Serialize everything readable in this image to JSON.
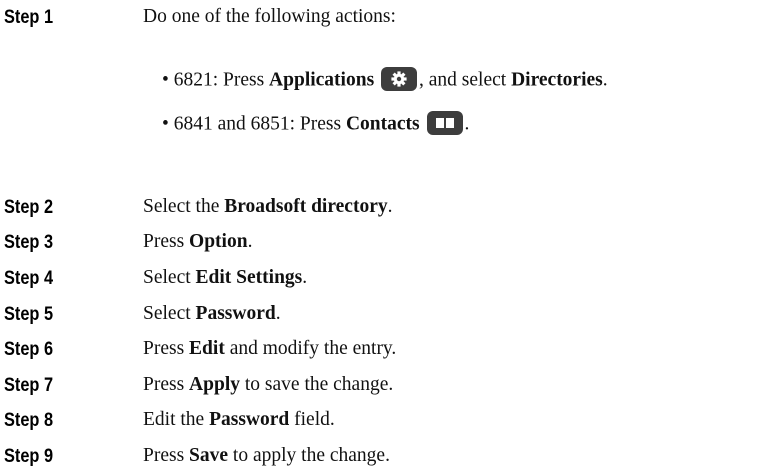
{
  "steps": [
    {
      "label": "Step 1",
      "text": "Do one of the following actions:"
    },
    {
      "label": "Step 2",
      "prefix": "Select the ",
      "bold": "Broadsoft directory",
      "suffix": "."
    },
    {
      "label": "Step 3",
      "prefix": "Press ",
      "bold": "Option",
      "suffix": "."
    },
    {
      "label": "Step 4",
      "prefix": "Select ",
      "bold": "Edit Settings",
      "suffix": "."
    },
    {
      "label": "Step 5",
      "prefix": "Select ",
      "bold": "Password",
      "suffix": "."
    },
    {
      "label": "Step 6",
      "prefix": "Press ",
      "bold": "Edit",
      "suffix": " and modify the entry."
    },
    {
      "label": "Step 7",
      "prefix": "Press ",
      "bold": "Apply",
      "suffix": " to save the change."
    },
    {
      "label": "Step 8",
      "prefix": "Edit the ",
      "bold": "Password",
      "suffix": " field."
    },
    {
      "label": "Step 9",
      "prefix": "Press ",
      "bold": "Save",
      "suffix": " to apply the change."
    }
  ],
  "bullets": [
    {
      "bullet": "•",
      "prefix": "6821: Press ",
      "bold1": "Applications",
      "icon": "gear-icon",
      "middle": ", and select ",
      "bold2": "Directories",
      "suffix": "."
    },
    {
      "bullet": "•",
      "prefix": "6841 and 6851: Press ",
      "bold1": "Contacts",
      "icon": "book-icon",
      "suffix": "."
    }
  ],
  "colors": {
    "icon_bg": "#3d3d3d",
    "icon_fg": "#ffffff"
  }
}
